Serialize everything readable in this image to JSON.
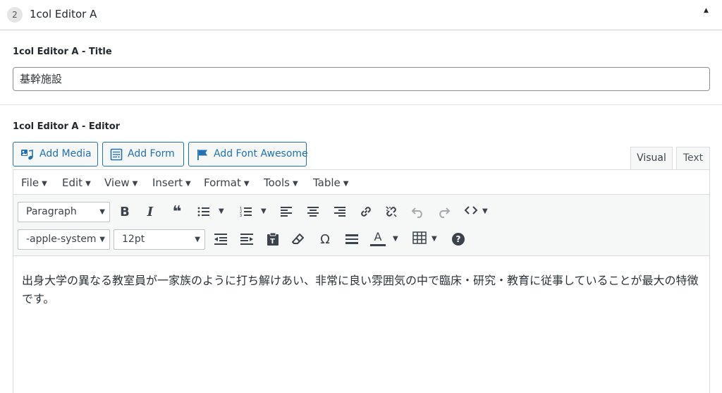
{
  "panel": {
    "number": "2",
    "title": "1col Editor A",
    "toggle": "▲"
  },
  "title_field": {
    "label": "1col Editor A - Title",
    "value": "基幹施設"
  },
  "editor_field": {
    "label": "1col Editor A - Editor"
  },
  "buttons": {
    "add_media": "Add Media",
    "add_form": "Add Form",
    "add_font_awesome": "Add Font Awesome"
  },
  "mode_tabs": {
    "visual": "Visual",
    "text": "Text",
    "active": "visual"
  },
  "menubar": [
    "File",
    "Edit",
    "View",
    "Insert",
    "Format",
    "Tools",
    "Table"
  ],
  "toolbar": {
    "format_select": "Paragraph",
    "font_family_select": "-apple-system",
    "font_size_select": "12pt",
    "row1_icons": [
      "bold-icon",
      "italic-icon",
      "blockquote-icon",
      "bullet-list-icon",
      "numbered-list-icon",
      "align-left-icon",
      "align-center-icon",
      "align-right-icon",
      "link-icon",
      "unlink-icon",
      "undo-icon",
      "redo-icon",
      "code-icon"
    ],
    "row2_icons": [
      "outdent-icon",
      "indent-icon",
      "paste-text-icon",
      "clear-formatting-icon",
      "special-character-icon",
      "horizontal-line-icon",
      "text-color-icon",
      "table-icon",
      "help-icon"
    ],
    "glyphs": {
      "bold": "B",
      "italic": "I",
      "blockquote": "❝",
      "omega": "Ω",
      "text_color": "A",
      "help": "?"
    }
  },
  "content": {
    "paragraph": "出身大学の異なる教室員が一家族のように打ち解けあい、非常に良い雰囲気の中で臨床・研究・教育に従事していることが最大の特徴です。"
  },
  "colors": {
    "accent": "#2271b1",
    "border": "#dcdcde",
    "toolbar_bg": "#f6f7f7"
  }
}
